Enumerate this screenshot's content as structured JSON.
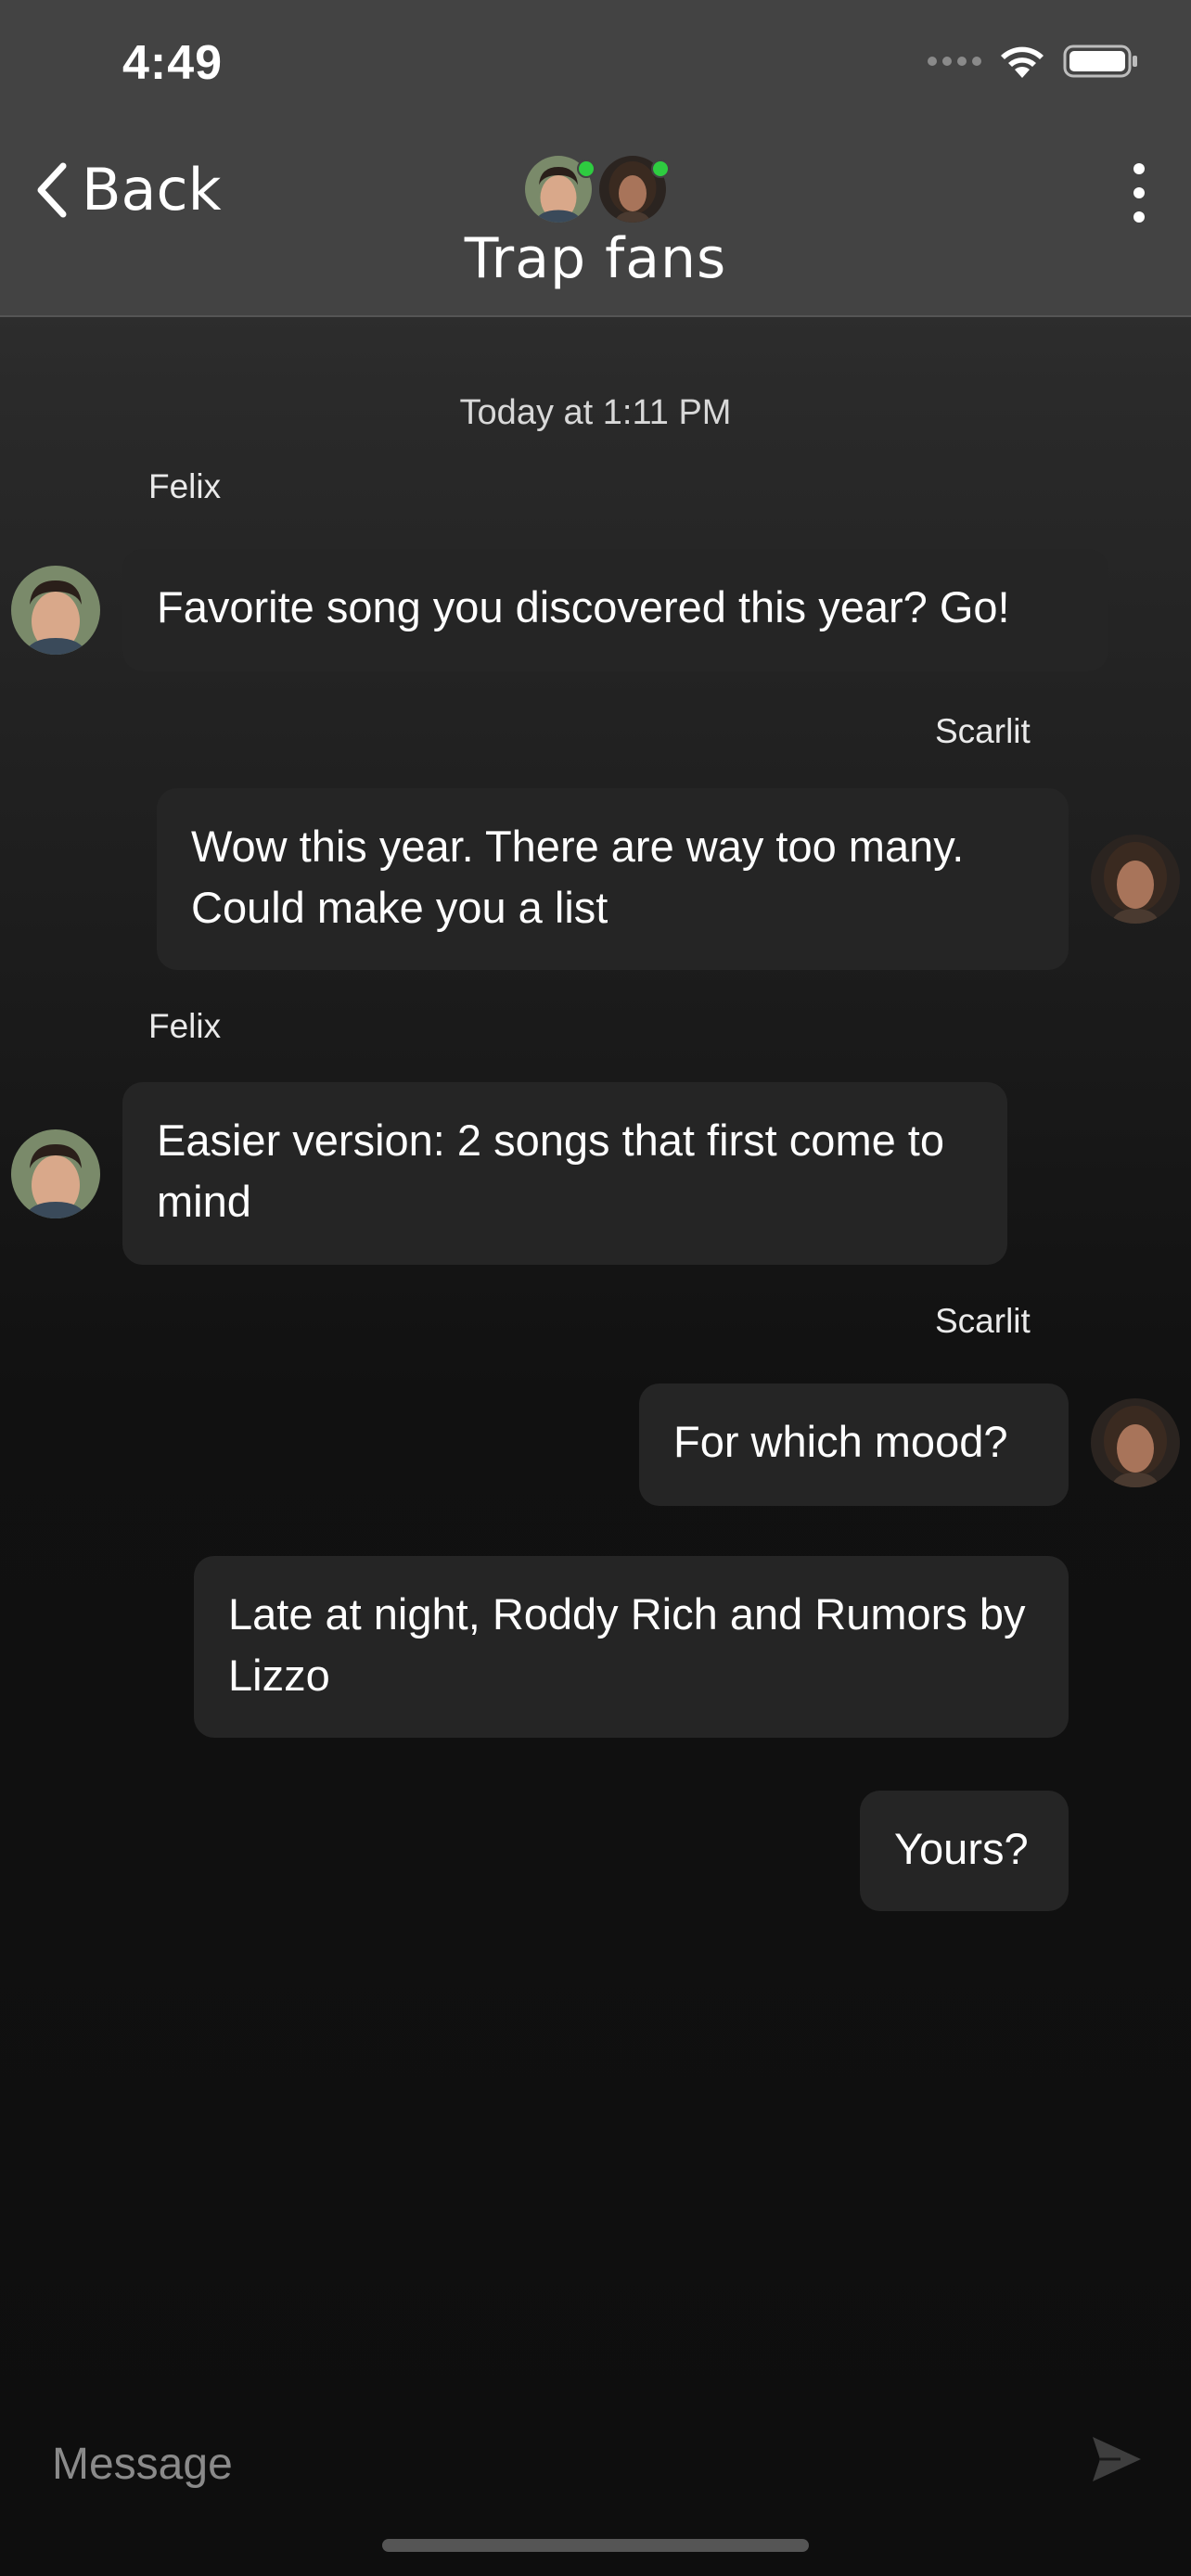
{
  "status_bar": {
    "time": "4:49"
  },
  "header": {
    "back_label": "Back",
    "title": "Trap fans"
  },
  "conversation": {
    "timestamp": "Today at 1:11 PM",
    "messages": [
      {
        "sender": "Felix",
        "text": "Favorite song you discovered this year? Go!"
      },
      {
        "sender": "Scarlit",
        "text": "Wow this year. There are way too many. Could make you a list"
      },
      {
        "sender": "Felix",
        "text": "Easier version: 2 songs that first come to mind"
      },
      {
        "sender": "Scarlit",
        "text": "For which mood?"
      },
      {
        "sender": "Scarlit",
        "text": "Late at night, Roddy Rich and Rumors by Lizzo"
      },
      {
        "sender": "Scarlit",
        "text": "Yours?"
      }
    ]
  },
  "composer": {
    "placeholder": "Message"
  },
  "colors": {
    "online": "#2ecc40",
    "bubble": "#252525",
    "header": "#434343"
  }
}
